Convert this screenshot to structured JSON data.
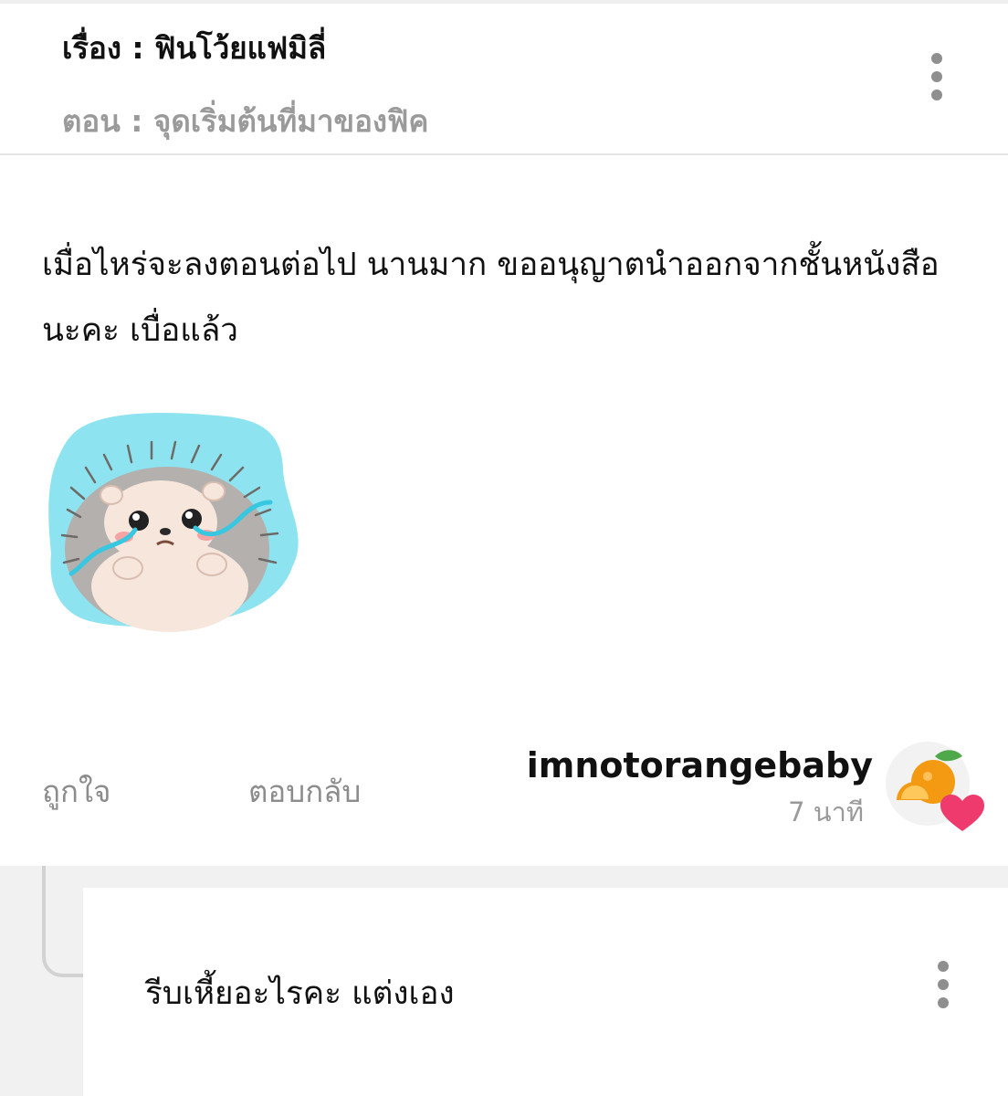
{
  "header": {
    "story_title": "เรื่อง : ฟินโว้ยแฟมิลี่",
    "chapter_title": "ตอน : จุดเริ่มต้นที่มาของฟิค"
  },
  "comment": {
    "text": "เมื่อไหร่จะลงตอนต่อไป นานมาก ขออนุญาตนำออกจากชั้นหนังสือนะคะ เบื่อแล้ว",
    "sticker_icon": "crying-hedgehog-sticker",
    "actions": {
      "like_label": "ถูกใจ",
      "reply_label": "ตอบกลับ"
    },
    "author": {
      "username": "imnotorangebaby",
      "time": "7 นาที",
      "avatar_icon": "orange-heart-avatar"
    }
  },
  "reply": {
    "text": "รีบเหี้ยอะไรคะ แต่งเอง"
  },
  "colors": {
    "heart": "#ee3a6d",
    "orange": "#f39a12",
    "sticker_bg": "#8ee3f0",
    "muted_text": "#9a9a9a"
  }
}
